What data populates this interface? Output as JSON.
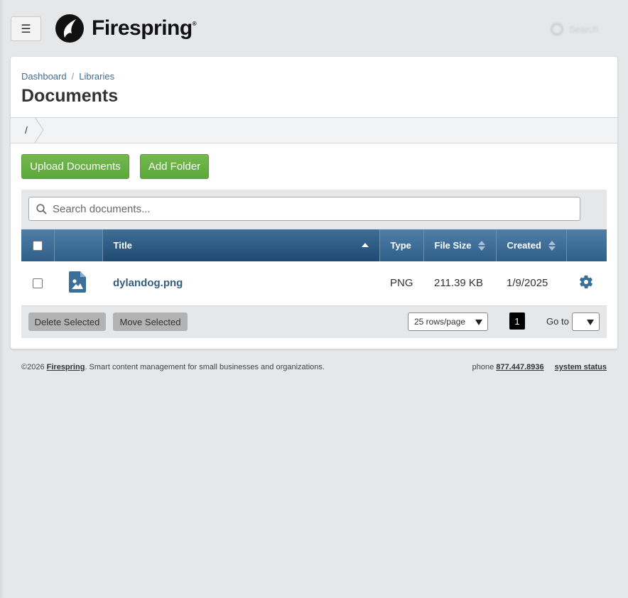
{
  "header": {
    "menu_icon": "hamburger-icon",
    "logo_text": "Firespring",
    "logo_reg": "®",
    "top_search_label": "Search"
  },
  "breadcrumb": {
    "items": [
      "Dashboard",
      "Libraries"
    ],
    "separator": "/"
  },
  "page": {
    "title": "Documents",
    "path_root": "/"
  },
  "actions": {
    "upload_label": "Upload Documents",
    "add_folder_label": "Add Folder"
  },
  "search": {
    "placeholder": "Search documents..."
  },
  "table": {
    "columns": [
      "",
      "",
      "Title",
      "Type",
      "File Size",
      "Created",
      ""
    ],
    "sorted_column": "Title",
    "rows": [
      {
        "icon": "image-file-icon",
        "title": "dylandog.png",
        "type": "PNG",
        "size": "211.39 KB",
        "created": "1/9/2025",
        "action_icon": "gear-icon"
      }
    ]
  },
  "grid_footer": {
    "delete_label": "Delete Selected",
    "move_label": "Move Selected",
    "rows_per_page": "25 rows/page",
    "current_page": "1",
    "goto_label": "Go to"
  },
  "footer": {
    "copyright": "©2026",
    "brand": "Firespring",
    "tagline": ". Smart content management for small businesses and organizations.",
    "phone_label": "phone",
    "phone": "877.447.8936",
    "status_link": "system status"
  },
  "colors": {
    "accent_green": "#5ca83a",
    "header_blue": "#2f5f89",
    "link_blue": "#345d80",
    "page_bg": "#e6e7e9"
  }
}
